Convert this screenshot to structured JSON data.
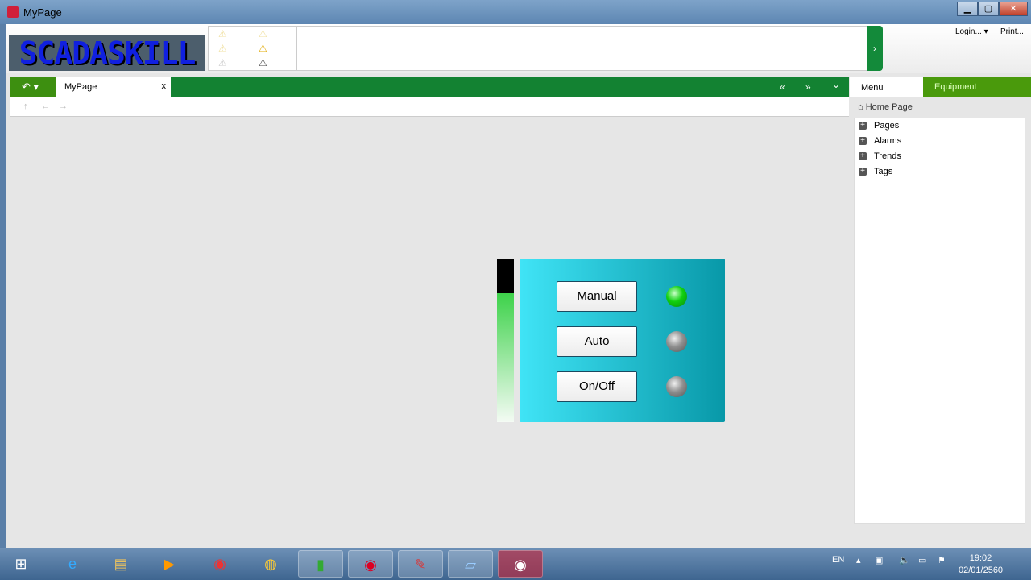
{
  "window": {
    "title": "MyPage",
    "minimize": "▁",
    "maximize": "▢",
    "close": "✕"
  },
  "header": {
    "logo": "SCADASKILL",
    "login": "Login...  ▾",
    "print": "Print...",
    "go": "›"
  },
  "tabs": {
    "back": "↶ ▾",
    "page_tab": "MyPage",
    "close": "x",
    "first": "«",
    "last": "»",
    "menu": "⌄"
  },
  "nav": {
    "up": "↑",
    "back": "←",
    "forward": "→"
  },
  "sidebar": {
    "tab_menu": "Menu",
    "tab_equipment": "Equipment",
    "home": "Home Page",
    "items": [
      {
        "label": "Pages"
      },
      {
        "label": "Alarms"
      },
      {
        "label": "Trends"
      },
      {
        "label": "Tags"
      }
    ]
  },
  "faceplate": {
    "level_percent": 79,
    "buttons": [
      {
        "label": "Manual",
        "state": "on"
      },
      {
        "label": "Auto",
        "state": "off"
      },
      {
        "label": "On/Off",
        "state": "off"
      }
    ]
  },
  "taskbar": {
    "lang": "EN",
    "time": "19:02",
    "date": "02/01/2560"
  },
  "colors": {
    "accent": "#138232",
    "equipment_tab": "#4a9a0c"
  }
}
